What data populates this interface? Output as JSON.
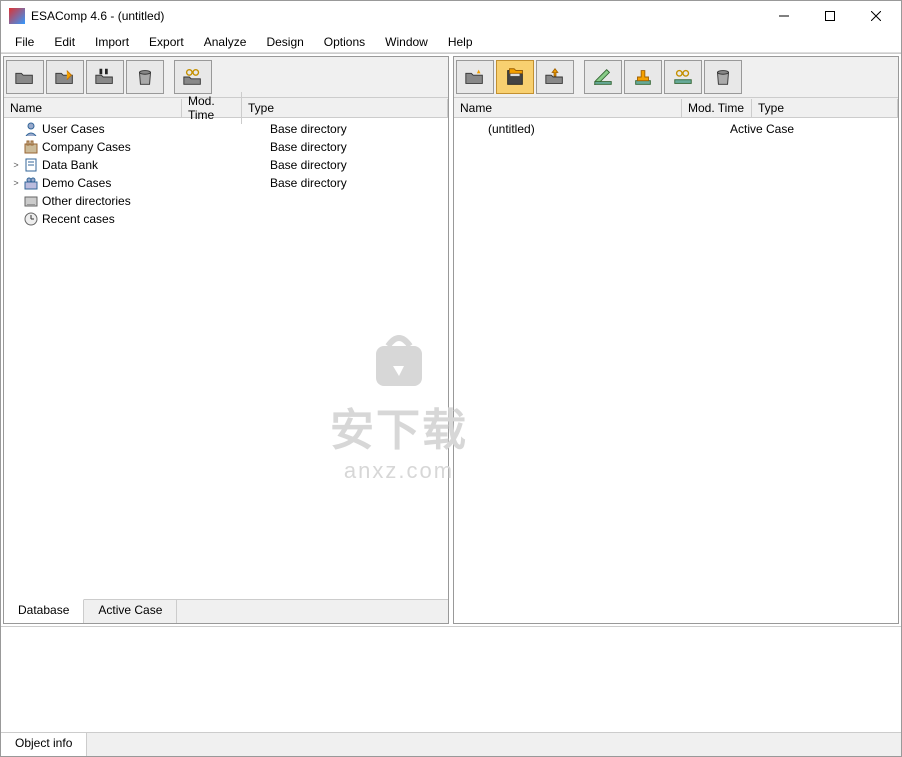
{
  "titlebar": {
    "title": "ESAComp 4.6 - (untitled)"
  },
  "menu": {
    "items": [
      "File",
      "Edit",
      "Import",
      "Export",
      "Analyze",
      "Design",
      "Options",
      "Window",
      "Help"
    ]
  },
  "left": {
    "headers": {
      "name": "Name",
      "mod": "Mod. Time",
      "type": "Type"
    },
    "rows": [
      {
        "name": "User Cases",
        "type": "Base directory",
        "icon": "user",
        "expand": ""
      },
      {
        "name": "Company Cases",
        "type": "Base directory",
        "icon": "company",
        "expand": ""
      },
      {
        "name": "Data Bank",
        "type": "Base directory",
        "icon": "data",
        "expand": ">"
      },
      {
        "name": "Demo Cases",
        "type": "Base directory",
        "icon": "demo",
        "expand": ">"
      },
      {
        "name": "Other directories",
        "type": "",
        "icon": "other",
        "expand": ""
      },
      {
        "name": "Recent cases",
        "type": "",
        "icon": "recent",
        "expand": ""
      }
    ]
  },
  "right": {
    "headers": {
      "name": "Name",
      "mod": "Mod. Time",
      "type": "Type"
    },
    "rows": [
      {
        "name": "(untitled)",
        "type": "Active Case"
      }
    ]
  },
  "tabs": {
    "database": "Database",
    "active": "Active Case"
  },
  "status": {
    "objectinfo": "Object info"
  },
  "watermark": {
    "big": "安下载",
    "small": "anxz.com"
  }
}
